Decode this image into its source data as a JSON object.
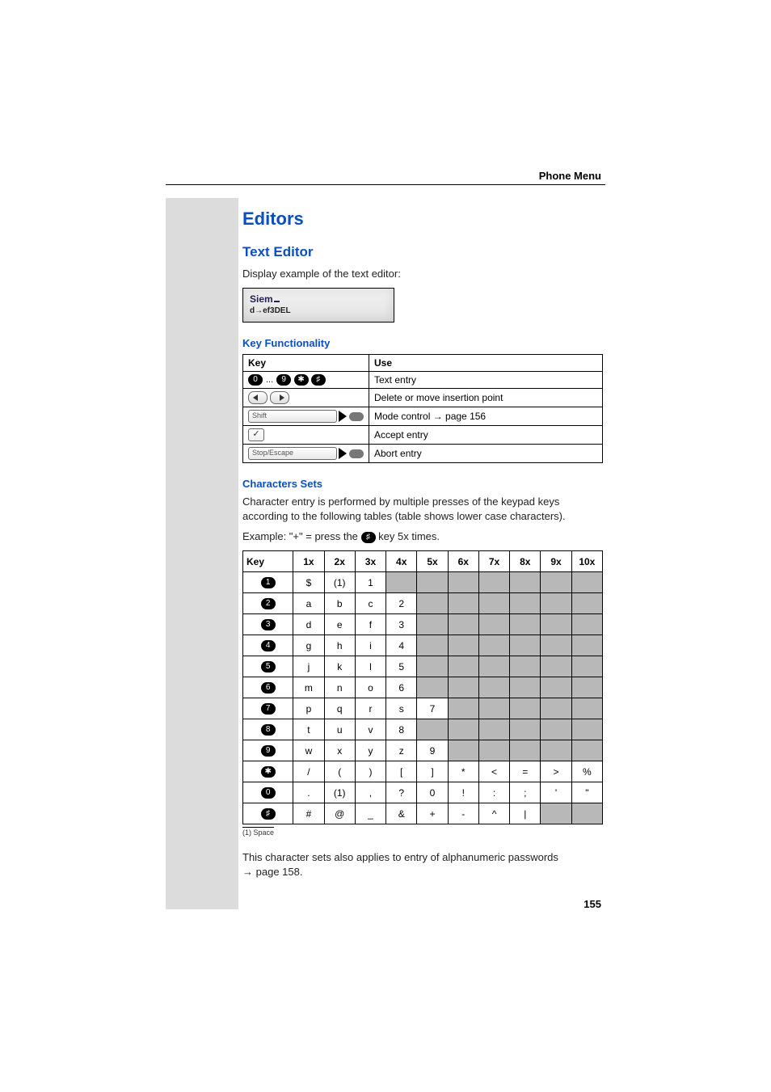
{
  "header": {
    "section": "Phone Menu"
  },
  "page_number": "155",
  "headings": {
    "h2": "Editors",
    "h3_text_editor": "Text Editor",
    "h4_key_func": "Key Functionality",
    "h4_char_sets": "Characters Sets"
  },
  "paragraphs": {
    "display_example": "Display example of the text editor:",
    "char_intro": "Character entry is performed by multiple presses of the keypad keys according to the following tables (table shows lower case characters).",
    "example_prefix": "Example: \"+\" = press the ",
    "example_suffix": " key 5x times.",
    "applies_prefix": "This character sets also applies to entry of alphanumeric passwords ",
    "applies_link": "page 158",
    "applies_dot": "."
  },
  "lcd": {
    "line1": "Siem",
    "line2_prefix": "d",
    "line2_arrow": "→",
    "line2_suffix": "ef3DEL"
  },
  "func_table": {
    "headers": [
      "Key",
      "Use"
    ],
    "rows": [
      {
        "key_type": "digits",
        "key_icons": [
          "0",
          "9",
          "star",
          "hash"
        ],
        "use": "Text entry"
      },
      {
        "key_type": "nav",
        "use": "Delete or move insertion point"
      },
      {
        "key_type": "longkey",
        "label": "Shift",
        "use_prefix": "Mode control ",
        "use_link": "page 156"
      },
      {
        "key_type": "check",
        "use": "Accept entry"
      },
      {
        "key_type": "longkey",
        "label": "Stop/Escape",
        "use": "Abort entry"
      }
    ]
  },
  "char_table": {
    "headers": [
      "Key",
      "1x",
      "2x",
      "3x",
      "4x",
      "5x",
      "6x",
      "7x",
      "8x",
      "9x",
      "10x"
    ],
    "rows": [
      {
        "key": "1",
        "cells": [
          "$",
          "(1)",
          "1",
          "",
          "",
          "",
          "",
          "",
          "",
          ""
        ]
      },
      {
        "key": "2",
        "cells": [
          "a",
          "b",
          "c",
          "2",
          "",
          "",
          "",
          "",
          "",
          ""
        ]
      },
      {
        "key": "3",
        "cells": [
          "d",
          "e",
          "f",
          "3",
          "",
          "",
          "",
          "",
          "",
          ""
        ]
      },
      {
        "key": "4",
        "cells": [
          "g",
          "h",
          "i",
          "4",
          "",
          "",
          "",
          "",
          "",
          ""
        ]
      },
      {
        "key": "5",
        "cells": [
          "j",
          "k",
          "l",
          "5",
          "",
          "",
          "",
          "",
          "",
          ""
        ]
      },
      {
        "key": "6",
        "cells": [
          "m",
          "n",
          "o",
          "6",
          "",
          "",
          "",
          "",
          "",
          ""
        ]
      },
      {
        "key": "7",
        "cells": [
          "p",
          "q",
          "r",
          "s",
          "7",
          "",
          "",
          "",
          "",
          ""
        ]
      },
      {
        "key": "8",
        "cells": [
          "t",
          "u",
          "v",
          "8",
          "",
          "",
          "",
          "",
          "",
          ""
        ]
      },
      {
        "key": "9",
        "cells": [
          "w",
          "x",
          "y",
          "z",
          "9",
          "",
          "",
          "",
          "",
          ""
        ]
      },
      {
        "key": "star",
        "cells": [
          "/",
          "(",
          ")",
          "[",
          "]",
          "*",
          "<",
          "=",
          ">",
          "%"
        ]
      },
      {
        "key": "0",
        "cells": [
          ".",
          "(1)",
          ",",
          "?",
          "0",
          "!",
          ":",
          ";",
          "'",
          "\""
        ]
      },
      {
        "key": "hash",
        "cells": [
          "#",
          "@",
          "_",
          "&",
          "+",
          "-",
          "^",
          "|",
          "",
          ""
        ]
      }
    ],
    "footnote": "(1)   Space"
  },
  "icon_glyphs": {
    "star": "✱",
    "hash": "♯",
    "check": "✓",
    "arrow": "→"
  }
}
